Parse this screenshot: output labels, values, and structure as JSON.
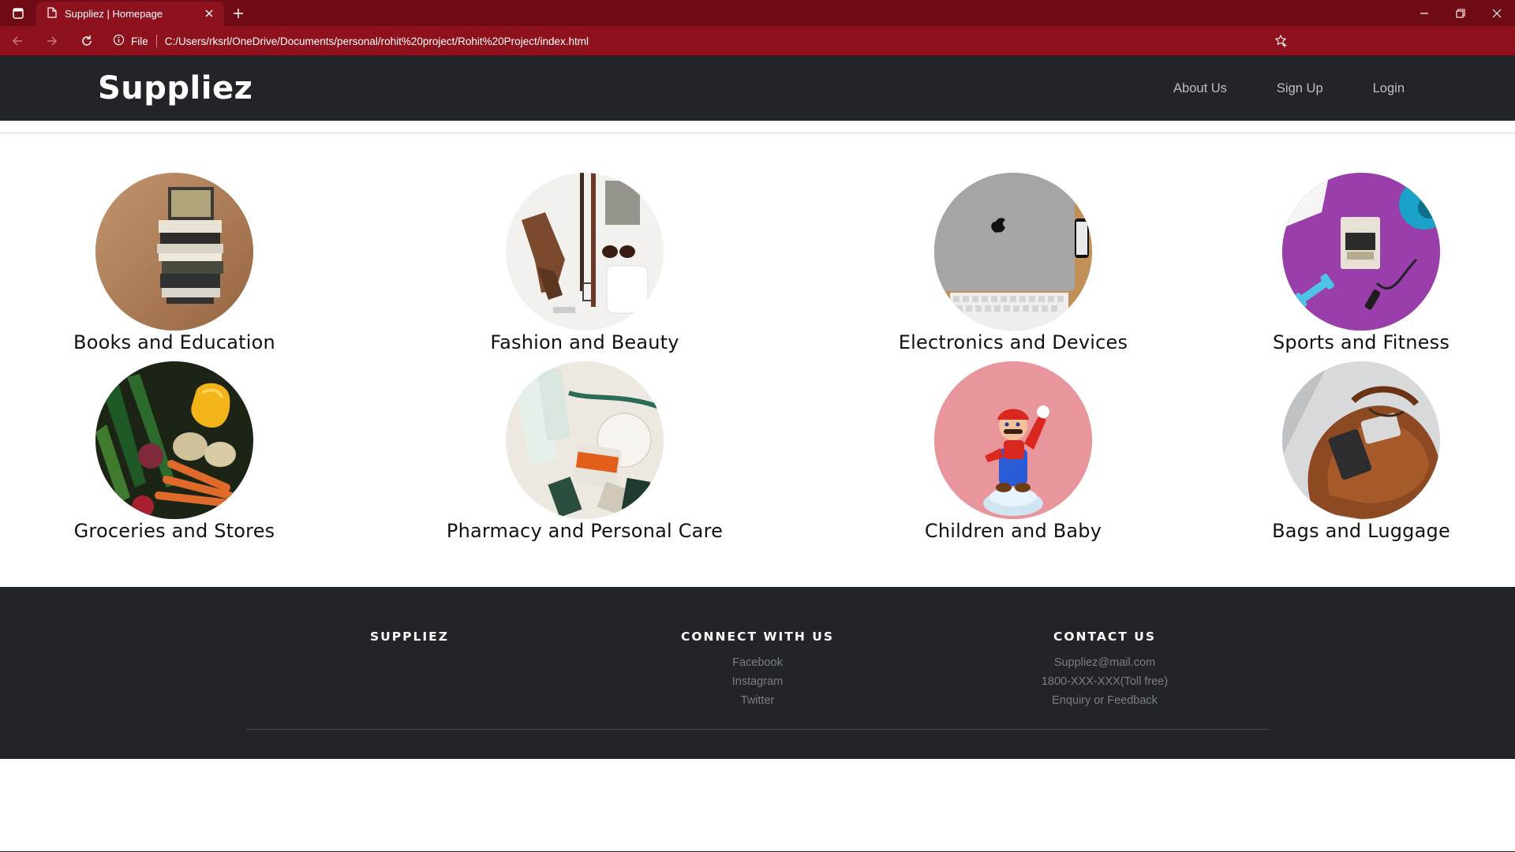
{
  "browser": {
    "tab_title": "Suppliez | Homepage",
    "scheme_label": "File",
    "url": "C:/Users/rksrl/OneDrive/Documents/personal/rohit%20project/Rohit%20Project/index.html"
  },
  "site": {
    "brand": "Suppliez",
    "nav": {
      "about": "About Us",
      "signup": "Sign Up",
      "login": "Login"
    }
  },
  "categories": [
    {
      "label": "Books and Education"
    },
    {
      "label": "Fashion and Beauty"
    },
    {
      "label": "Electronics and Devices"
    },
    {
      "label": "Sports and Fitness"
    },
    {
      "label": "Groceries and Stores"
    },
    {
      "label": "Pharmacy and Personal Care"
    },
    {
      "label": "Children and Baby"
    },
    {
      "label": "Bags and Luggage"
    }
  ],
  "footer": {
    "col1": {
      "heading": "SUPPLIEZ"
    },
    "col2": {
      "heading": "CONNECT WITH US",
      "links": [
        "Facebook",
        "Instagram",
        "Twitter"
      ]
    },
    "col3": {
      "heading": "CONTACT US",
      "links": [
        "Suppliez@mail.com",
        "1800-XXX-XXX(Toll free)",
        "Enquiry or Feedback"
      ]
    }
  },
  "colors": {
    "browser_frame": "#8e121d",
    "navbar_bg": "#212529",
    "footer_bg": "#212529"
  }
}
